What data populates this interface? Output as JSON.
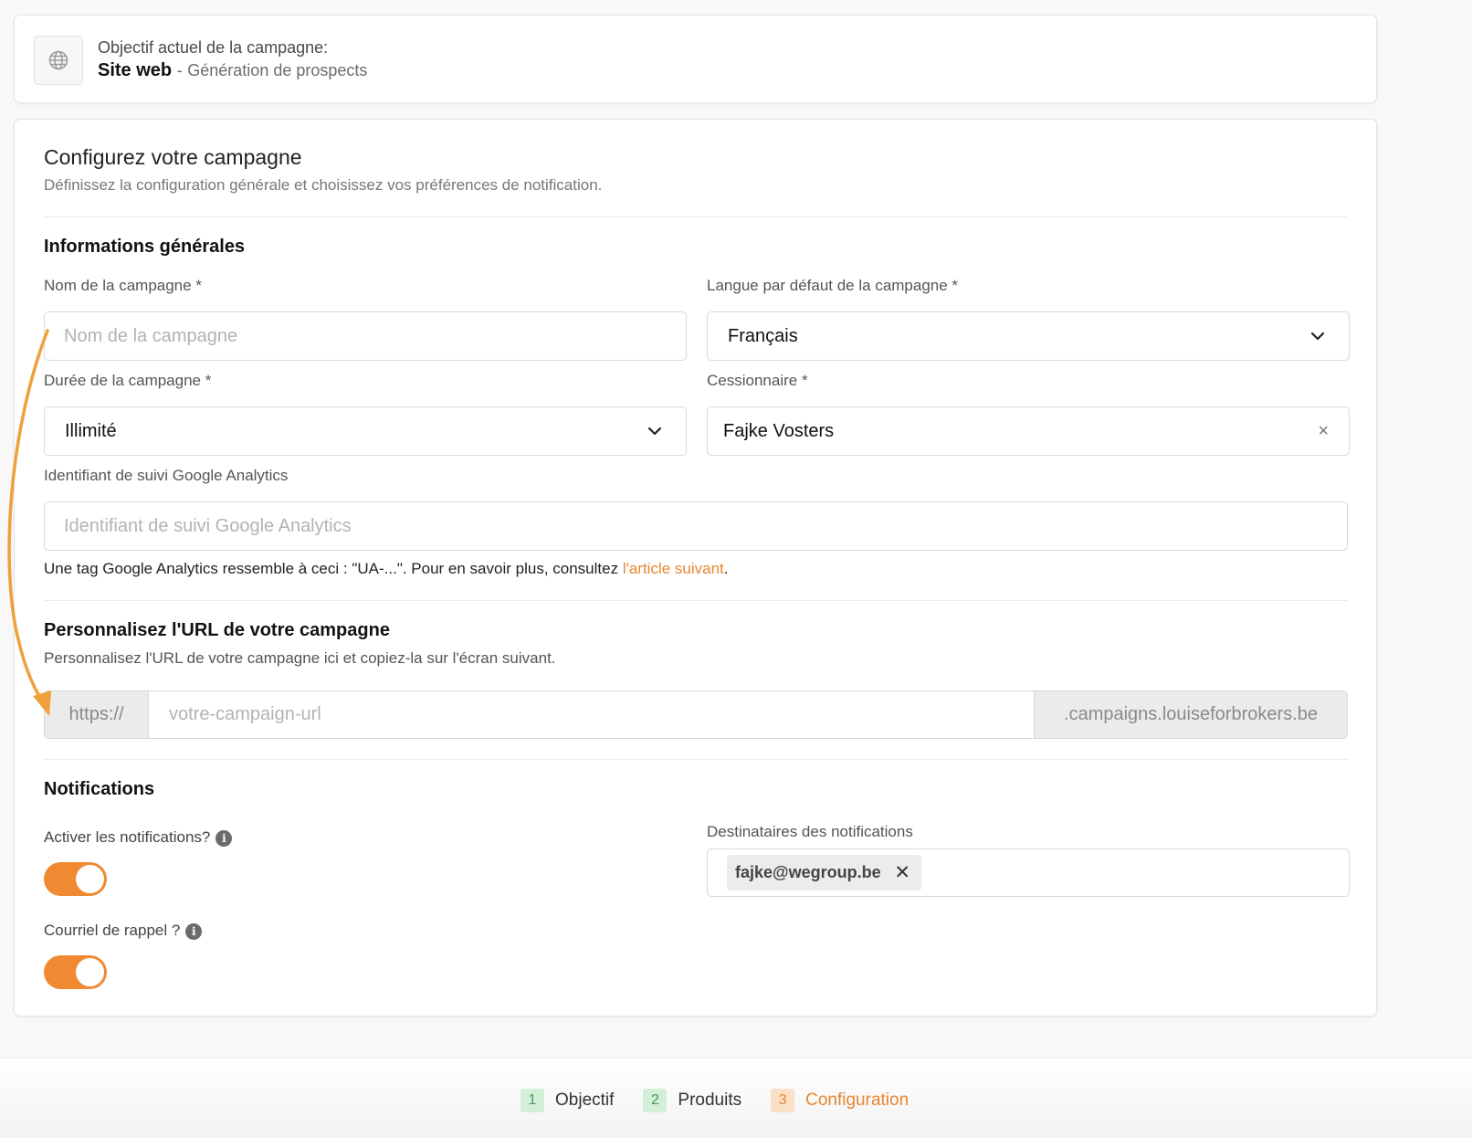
{
  "goal": {
    "label": "Objectif actuel de la campagne:",
    "value": "Site web",
    "separator": "-",
    "sub": "Génération de prospects",
    "icon": "globe-icon"
  },
  "config": {
    "title": "Configurez votre campagne",
    "subtitle": "Définissez la configuration générale et choisissez vos préférences de notification."
  },
  "general": {
    "title": "Informations générales",
    "campaign_name": {
      "label": "Nom de la campagne *",
      "placeholder": "Nom de la campagne",
      "value": ""
    },
    "language": {
      "label": "Langue par défaut de la campagne *",
      "value": "Français"
    },
    "duration": {
      "label": "Durée de la campagne *",
      "value": "Illimité"
    },
    "assignee": {
      "label": "Cessionnaire *",
      "value": "Fajke Vosters",
      "clear": "×"
    },
    "ga": {
      "label": "Identifiant de suivi Google Analytics",
      "placeholder": "Identifiant de suivi Google Analytics",
      "help_before": "Une tag Google Analytics ressemble à ceci : \"UA-...\". Pour en savoir plus, consultez ",
      "help_link": "l'article suivant",
      "help_after": "."
    }
  },
  "url": {
    "title": "Personnalisez l'URL de votre campagne",
    "subtitle": "Personnalisez l'URL de votre campagne ici et copiez-la sur l'écran suivant.",
    "prefix": "https://",
    "placeholder": "votre-campaign-url",
    "suffix": ".campaigns.louiseforbrokers.be"
  },
  "notifications": {
    "title": "Notifications",
    "enable_label": "Activer les notifications?",
    "enable_on": true,
    "reminder_label": "Courriel de rappel ?",
    "reminder_on": true,
    "recipients_label": "Destinataires des notifications",
    "recipients": [
      "fajke@wegroup.be"
    ],
    "info_glyph": "i"
  },
  "steps": [
    {
      "num": "1",
      "label": "Objectif",
      "state": "done"
    },
    {
      "num": "2",
      "label": "Produits",
      "state": "done"
    },
    {
      "num": "3",
      "label": "Configuration",
      "state": "active"
    }
  ],
  "colors": {
    "accent": "#ef8a32",
    "link": "#e8862e",
    "step_done_bg": "#d3efd8",
    "step_active_bg": "#fbe0c7"
  }
}
